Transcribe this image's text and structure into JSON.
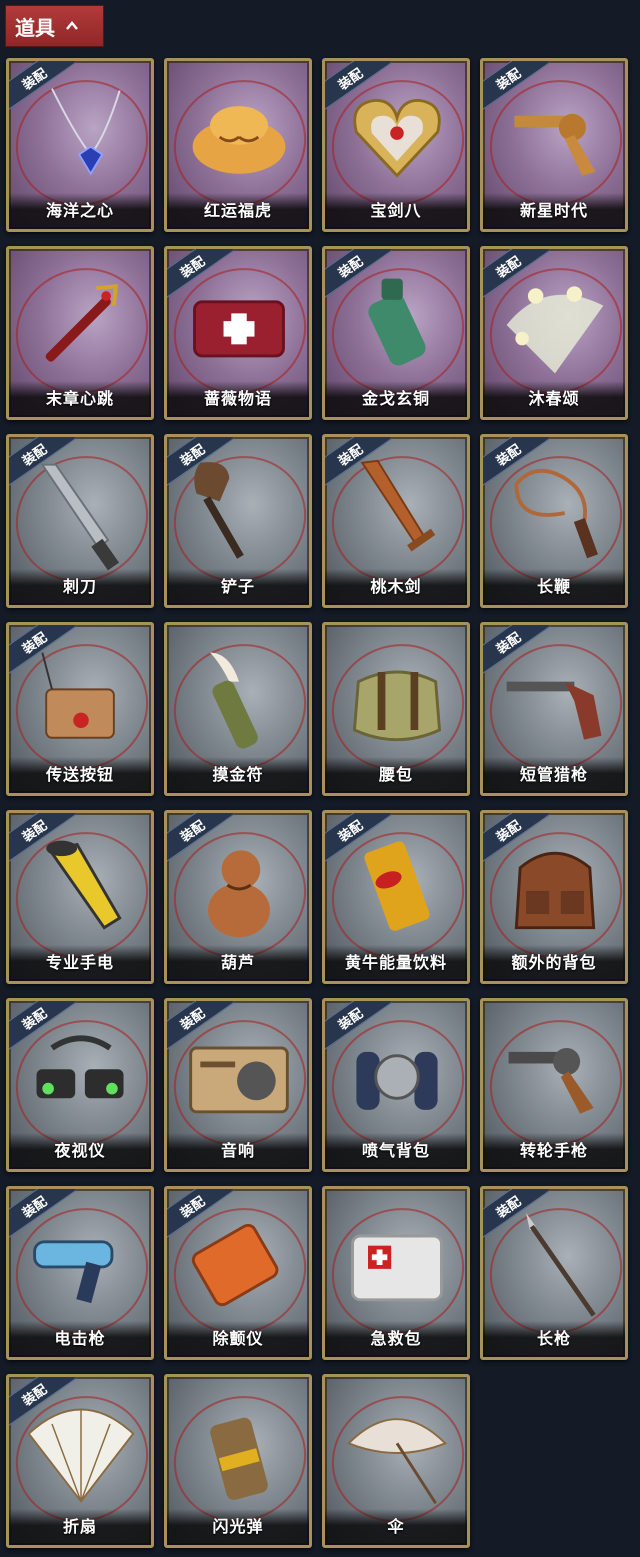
{
  "header": {
    "title": "道具",
    "chevron_icon": "chevron-up-icon"
  },
  "items": [
    {
      "label": "海洋之心",
      "equipped": true,
      "rarity": "purple",
      "icon": "necklace-icon"
    },
    {
      "label": "红运福虎",
      "equipped": false,
      "rarity": "purple",
      "icon": "tiger-plush-icon"
    },
    {
      "label": "宝剑八",
      "equipped": true,
      "rarity": "purple",
      "icon": "heart-box-icon"
    },
    {
      "label": "新星时代",
      "equipped": true,
      "rarity": "purple",
      "icon": "revolver-icon"
    },
    {
      "label": "末章心跳",
      "equipped": false,
      "rarity": "purple",
      "icon": "syringe-icon"
    },
    {
      "label": "蔷薇物语",
      "equipped": true,
      "rarity": "purple",
      "icon": "medkit-icon"
    },
    {
      "label": "金戈玄铜",
      "equipped": true,
      "rarity": "purple",
      "icon": "bronze-grenade-icon"
    },
    {
      "label": "沐春颂",
      "equipped": true,
      "rarity": "purple",
      "icon": "flower-umbrella-icon"
    },
    {
      "label": "刺刀",
      "equipped": true,
      "rarity": "gray",
      "icon": "bayonet-icon"
    },
    {
      "label": "铲子",
      "equipped": true,
      "rarity": "gray",
      "icon": "shovel-icon"
    },
    {
      "label": "桃木剑",
      "equipped": true,
      "rarity": "gray",
      "icon": "wooden-sword-icon"
    },
    {
      "label": "长鞭",
      "equipped": true,
      "rarity": "gray",
      "icon": "whip-icon"
    },
    {
      "label": "传送按钮",
      "equipped": true,
      "rarity": "gray",
      "icon": "teleport-button-icon"
    },
    {
      "label": "摸金符",
      "equipped": false,
      "rarity": "gray",
      "icon": "talisman-icon"
    },
    {
      "label": "腰包",
      "equipped": false,
      "rarity": "gray",
      "icon": "waist-bag-icon"
    },
    {
      "label": "短管猎枪",
      "equipped": true,
      "rarity": "gray",
      "icon": "shotgun-icon"
    },
    {
      "label": "专业手电",
      "equipped": true,
      "rarity": "gray",
      "icon": "flashlight-icon"
    },
    {
      "label": "葫芦",
      "equipped": true,
      "rarity": "gray",
      "icon": "gourd-icon"
    },
    {
      "label": "黄牛能量饮料",
      "equipped": true,
      "rarity": "gray",
      "icon": "energy-drink-icon"
    },
    {
      "label": "额外的背包",
      "equipped": true,
      "rarity": "gray",
      "icon": "backpack-icon"
    },
    {
      "label": "夜视仪",
      "equipped": true,
      "rarity": "gray",
      "icon": "night-vision-icon"
    },
    {
      "label": "音响",
      "equipped": true,
      "rarity": "gray",
      "icon": "radio-icon"
    },
    {
      "label": "喷气背包",
      "equipped": true,
      "rarity": "gray",
      "icon": "jetpack-icon"
    },
    {
      "label": "转轮手枪",
      "equipped": false,
      "rarity": "gray",
      "icon": "pistol-icon"
    },
    {
      "label": "电击枪",
      "equipped": true,
      "rarity": "gray",
      "icon": "stun-gun-icon"
    },
    {
      "label": "除颤仪",
      "equipped": true,
      "rarity": "gray",
      "icon": "defibrillator-icon"
    },
    {
      "label": "急救包",
      "equipped": false,
      "rarity": "gray",
      "icon": "first-aid-icon"
    },
    {
      "label": "长枪",
      "equipped": true,
      "rarity": "gray",
      "icon": "spear-icon"
    },
    {
      "label": "折扇",
      "equipped": true,
      "rarity": "gray",
      "icon": "folding-fan-icon"
    },
    {
      "label": "闪光弹",
      "equipped": false,
      "rarity": "gray",
      "icon": "flashbang-icon"
    },
    {
      "label": "伞",
      "equipped": false,
      "rarity": "gray",
      "icon": "umbrella-icon"
    }
  ],
  "badge_text": "装配",
  "colors": {
    "header_bg": "#a83232",
    "page_bg": "#141a26",
    "frame_gold": "#a9915a",
    "badge_bg": "#27354d"
  }
}
